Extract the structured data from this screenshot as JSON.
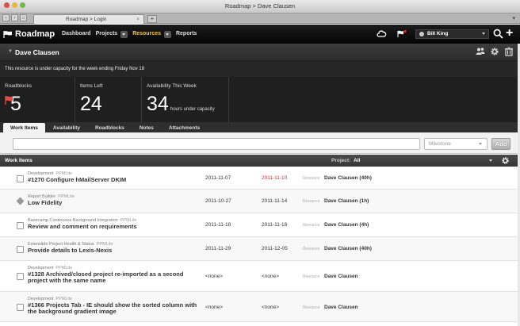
{
  "window": {
    "title": "Roadmap > Dave Clausen"
  },
  "browser": {
    "tab_title": "Roadmap > Login",
    "tab_close": "×",
    "new_tab": "+"
  },
  "nav": {
    "brand": "Roadmap",
    "items": [
      {
        "label": "Dashboard",
        "active": false,
        "dropdown": false
      },
      {
        "label": "Projects",
        "active": false,
        "dropdown": true
      },
      {
        "label": "Resources",
        "active": true,
        "dropdown": true
      },
      {
        "label": "Reports",
        "active": false,
        "dropdown": false
      }
    ],
    "user": "Bill King",
    "plus": "+"
  },
  "resource": {
    "name": "Dave Clausen",
    "capacity_note": "This resource is under capacity for the week ending Friday Nov 18"
  },
  "stats": {
    "roadblocks_label": "Roadblocks",
    "roadblocks_value": "5",
    "items_left_label": "Items Left",
    "items_left_value": "24",
    "availability_label": "Availability This Week",
    "availability_value": "34",
    "availability_sub": "hours under capacity"
  },
  "tabs": [
    "Work Items",
    "Availability",
    "Roadblocks",
    "Notes",
    "Attachments"
  ],
  "add_bar": {
    "milestone_placeholder": "Milestone",
    "add_label": "Add"
  },
  "work_items": {
    "header": "Work Items",
    "project_label": "Project:",
    "project_value": "All",
    "resource_label": "Resource",
    "rows": [
      {
        "type": "checkbox",
        "category": "Development",
        "project": "PPMLite",
        "title": "#1270 Configure hMailServer DKIM",
        "start": "2011-11-07",
        "due": "2011-11-10",
        "late": true,
        "resource": "Dave Clausen (40h)"
      },
      {
        "type": "milestone",
        "category": "Report Builder",
        "project": "PPMLite",
        "title": "Low Fidelity",
        "start": "2011-10-27",
        "due": "2011-11-14",
        "late": false,
        "resource": "Dave Clausen (1h)"
      },
      {
        "type": "checkbox",
        "category": "Basecamp Continuous Background Integration",
        "project": "PPMLite",
        "title": "Review and comment on requirements",
        "start": "2011-11-18",
        "due": "2011-11-18",
        "late": false,
        "resource": "Dave Clausen (4h)"
      },
      {
        "type": "checkbox",
        "category": "Extensible Project Health & Status",
        "project": "PPMLite",
        "title": "Provide details to Lexis-Nexis",
        "start": "2011-11-29",
        "due": "2011-12-05",
        "late": false,
        "resource": "Dave Clausen (40h)"
      },
      {
        "type": "checkbox",
        "category": "Development",
        "project": "PPMLite",
        "title": "#1328 Archived/closed project re-imported as a second project with the same name",
        "start": "<none>",
        "due": "<none>",
        "late": false,
        "resource": "Dave Clausen"
      },
      {
        "type": "checkbox",
        "category": "Development",
        "project": "PPMLite",
        "title": "#1366 Projects Tab - IE should show the sorted column with the background gradient image",
        "start": "<none>",
        "due": "<none>",
        "late": false,
        "resource": "Dave Clausen"
      }
    ]
  }
}
